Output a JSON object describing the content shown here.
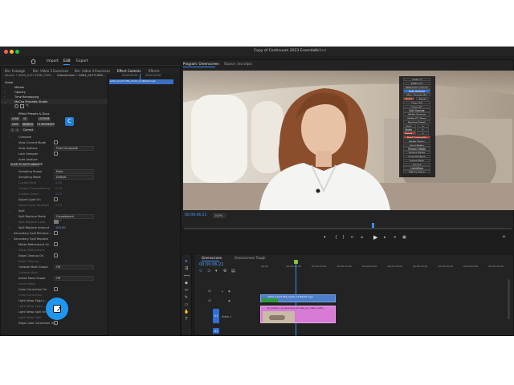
{
  "window": {
    "title": "Copy of Continuum 2023 Essentials",
    "status": "- Edited",
    "dot_colors": [
      "#ff5f57",
      "#febc2e",
      "#28c840"
    ]
  },
  "menu": {
    "import": "Import",
    "edit": "Edit",
    "export": "Export"
  },
  "left_tabs": {
    "tab1": "Bin: Footage",
    "tab2": "Bin: Video 5 Exercises",
    "tab3": "Bin: Video 4 Exercises",
    "tab4": "Effect Controls",
    "tab5": "Effects"
  },
  "effect_controls": {
    "source": "Source • A004_01271356_C020...",
    "sequence": "Greenscreen • A004_01271356...",
    "clip_name": "A004_01271356_C020_V1.BRAW.mp4",
    "timecode_1": "00:00:05:00",
    "timecode_2": "00:00:10:00",
    "section_video": "Video",
    "fx_motion": "Motion",
    "fx_opacity": "Opacity",
    "fx_time": "Time Remapping",
    "fx_plugin": "MoCha Primatte Studio",
    "presets": "Effect Presets & Docs",
    "btn_load": "LOAD",
    "btn_is": "IS",
    "btn_license": "LICENSE",
    "btn_save": "SAVE",
    "btn_search": "SEARCH",
    "btn_fx": "FX BROWSER",
    "btn_current": "Current",
    "compare": "Compare",
    "view_current_mode": "View Current Mode",
    "view_options": "View Options",
    "view_options_value": "Final Composite",
    "lock_sampler": "Lock Sampler",
    "auto_analyze": "Auto Analyze",
    "click_to_auto": "CLICK TO AUTO ANALYZE",
    "sampling_shape": "Sampling Shape",
    "sampling_shape_value": "Point",
    "sampling_mode": "Sampling Mode",
    "sampling_mode_value": "Default",
    "custom_red": "Custom Red",
    "custom_red_value": "0.00",
    "custom_transparency": "Custom Transparency",
    "custom_transparency_value": "0.00",
    "custom_green": "Custom Green",
    "custom_green_value": "0.00",
    "adjust_light_on": "Adjust Light On",
    "adjust_light_strength": "Adjust Light Strength",
    "adjust_light_strength_value": "0.00",
    "spill": "Spill",
    "spill_replace_mode": "Spill Replace Mode",
    "spill_replace_mode_value": "Complement",
    "spill_replace_color": "Spill Replace Color",
    "spill_replace_amount": "Spill Replace Amount",
    "spill_replace_amount_value": "100.00",
    "secondary_spill_remove": "Secondary Spill Remove...",
    "secondary_spill_replace": "Secondary Spill Replace",
    "matte_refinement_on": "Matte Refinement On",
    "matte_refinement": "Matte Refinement",
    "edge_cleanup_on": "Edge Cleanup On",
    "edge_cleanup": "Edge Cleanup",
    "outside_mask_shape": "Outside Mask Shape",
    "outside_mask_shape_value": "Off",
    "outside_mask": "Outside Mask",
    "inside_mask_shape": "Inside Mask Shape",
    "inside_mask_shape_value": "Off",
    "inside_mask": "Inside Mask",
    "color_correction_on": "Color Correction On",
    "color_correction": "Color Correction",
    "light_wrap_edge": "Light Wrap Edge (...",
    "light_wrap_edge_sub": "Light Wrap Edge...",
    "light_wrap_spill_on": "Light Wrap Spill On",
    "light_wrap_spill": "Light Wrap Spill",
    "edge_color_correction_on": "Edge Color Correction On"
  },
  "program": {
    "tab_program": "Program: Greenscreen",
    "tab_source": "Source: (no clips)",
    "timecode": "00:00:06:21",
    "zoom": "100%"
  },
  "overlay_menu": [
    {
      "label": "Hide UI",
      "style": "normal"
    },
    {
      "label": "BORIS FX",
      "style": "normal"
    },
    {
      "label": "PRIMATTE STUDIO",
      "style": "normal"
    },
    {
      "label": "Auto Analyze",
      "style": "blue"
    },
    {
      "label": "Man. Sample BG",
      "style": "normal"
    },
    {
      "label": "Reset",
      "style": "normal"
    },
    {
      "label": "Clean BG",
      "style": "normal"
    },
    {
      "label": "Clean FG",
      "style": "normal"
    },
    {
      "label": "Spill Sponge",
      "style": "normal"
    },
    {
      "label": "Matte Sponge",
      "style": "normal"
    },
    {
      "label": "Matte FG Trans",
      "style": "normal"
    },
    {
      "label": "Restore Detail",
      "style": "normal"
    },
    {
      "label": "Spill –",
      "style": "normal"
    },
    {
      "label": "Matte –",
      "style": "normal"
    },
    {
      "label": "Detail –",
      "style": "red"
    },
    {
      "label": "Final Composite",
      "style": "red"
    },
    {
      "label": "Matte Status",
      "style": "normal"
    },
    {
      "label": "Final Matte",
      "style": "normal"
    },
    {
      "label": "Primary Matte",
      "style": "normal"
    },
    {
      "label": "Hybrid Matte",
      "style": "normal"
    },
    {
      "label": "Outside Mask",
      "style": "normal"
    },
    {
      "label": "Inside Mask",
      "style": "normal"
    },
    {
      "label": "Source",
      "style": "normal"
    },
    {
      "label": "LightWrap",
      "style": "normal"
    },
    {
      "label": "Diff On Black",
      "style": "normal"
    }
  ],
  "overlay_side": {
    "point": "Point",
    "rect": "Rect",
    "spill_plus": "+",
    "matte_plus": "+",
    "detail_plus": "+"
  },
  "timeline": {
    "tab_greenscreen": "Greenscreen",
    "tab_tough": "Greenscreen Tough",
    "timecode": "00:00:06:21",
    "ruler": [
      "00:00",
      "00:00:05:00",
      "00:00:10:00",
      "00:00:15:00",
      "00:00:20:00",
      "00:00:25:00",
      "00:00:30:00",
      "00:00:35:00",
      "00:00:40:00",
      "00:00:45:00"
    ],
    "track_v3": "V3",
    "track_v2": "V2",
    "track_v1": "V1",
    "track_v1_name": "Video 1",
    "track_a1": "A1",
    "clip_top": "A004_01271356_C020_V1.BRAW.mp4",
    "clip_bottom": "fx_Interior_a_luxurious_private_jet_cabin_with_..."
  }
}
